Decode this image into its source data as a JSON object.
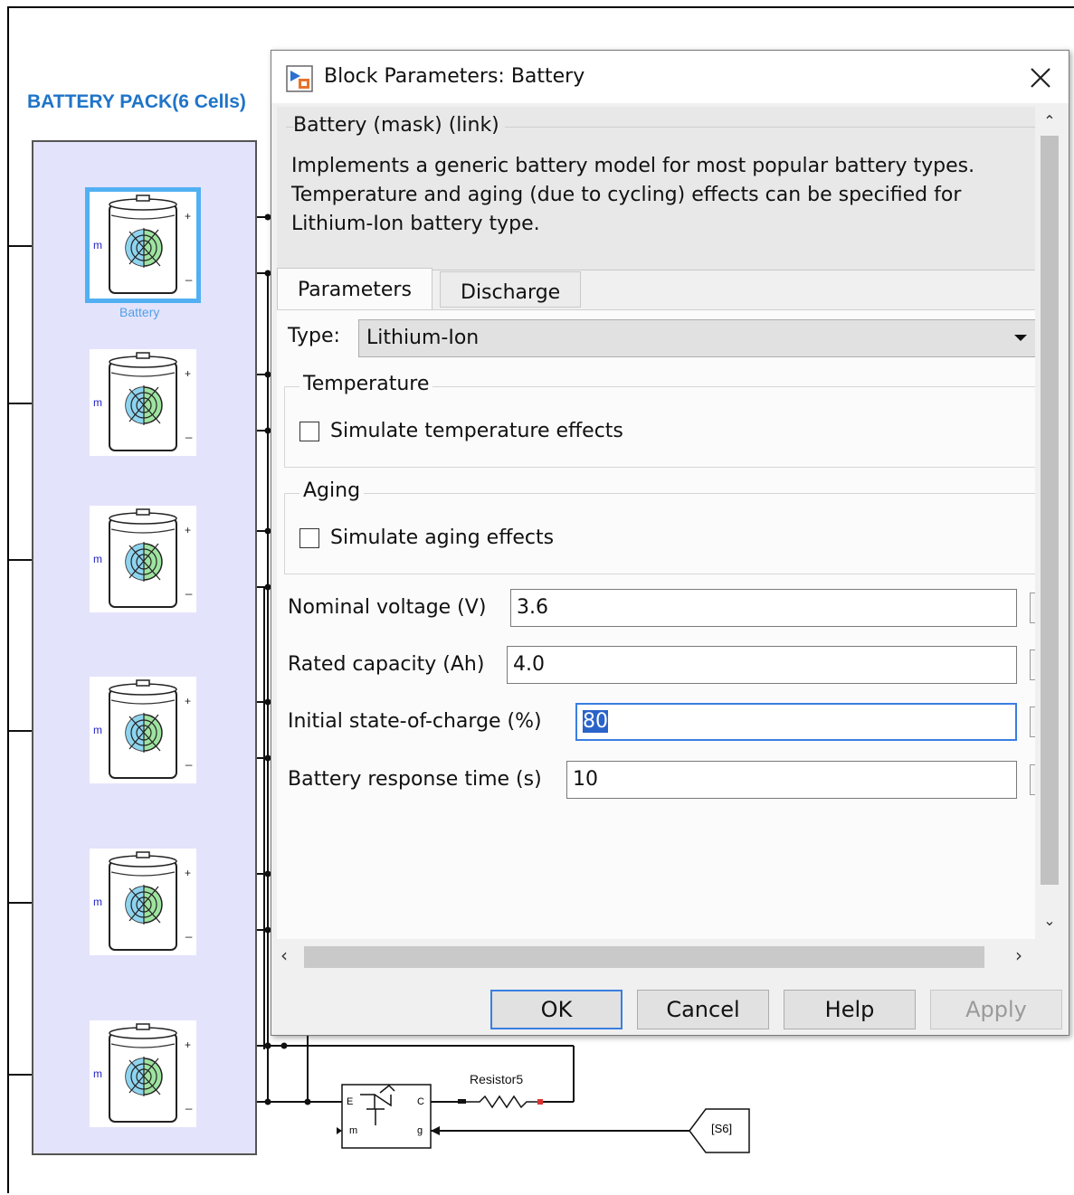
{
  "diagram": {
    "pack_title": "BATTERY PACK(6 Cells)",
    "cell_label": "Battery",
    "port_m": "m",
    "port_plus": "+",
    "port_minus": "_",
    "resistor_label": "Resistor5",
    "igbt_ports": {
      "e": "E",
      "c": "C",
      "m": "m",
      "g": "g"
    },
    "goto_tag": "[S6]",
    "cell_count": 6,
    "selected_cell_index": 0
  },
  "dialog": {
    "title": "Block Parameters: Battery",
    "mask_header": "Battery (mask) (link)",
    "mask_description": "Implements a generic battery model for most popular battery types. Temperature and aging (due to cycling) effects can be specified for Lithium-Ion battery type.",
    "tabs": [
      {
        "label": "Parameters",
        "active": true
      },
      {
        "label": "Discharge",
        "active": false
      }
    ],
    "type_label": "Type:",
    "type_value": "Lithium-Ion",
    "temperature": {
      "legend": "Temperature",
      "checkbox_label": "Simulate temperature effects",
      "checked": false
    },
    "aging": {
      "legend": "Aging",
      "checkbox_label": "Simulate aging effects",
      "checked": false
    },
    "params": [
      {
        "label": "Nominal voltage (V)",
        "value": "3.6"
      },
      {
        "label": "Rated capacity (Ah)",
        "value": "4.0"
      },
      {
        "label": "Initial state-of-charge (%)",
        "value": "80"
      },
      {
        "label": "Battery response time (s)",
        "value": "10"
      }
    ],
    "buttons": {
      "ok": "OK",
      "cancel": "Cancel",
      "help": "Help",
      "apply": "Apply"
    }
  },
  "colors": {
    "pack_title": "#1f74c8",
    "pack_background": "#e3e3fc",
    "selection_outline": "#52b0f2",
    "focus_border": "#3a7ee0"
  }
}
